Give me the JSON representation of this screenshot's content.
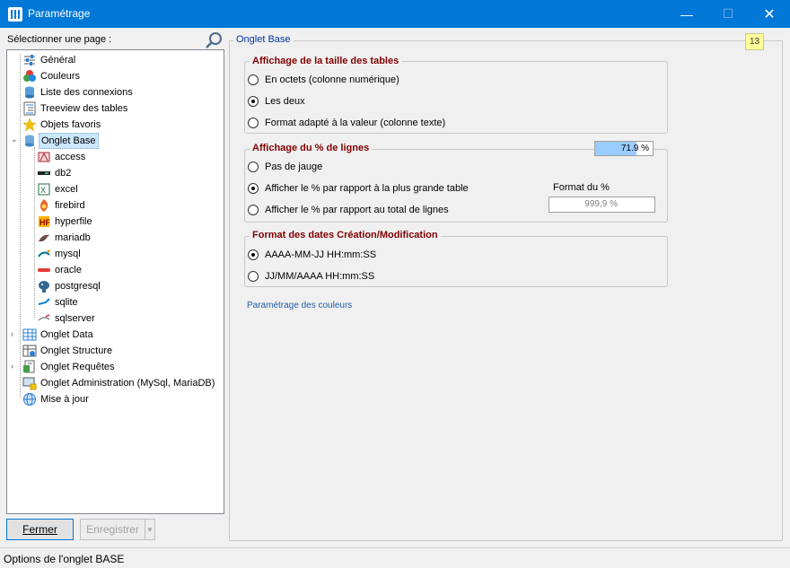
{
  "window": {
    "title": "Paramétrage"
  },
  "sidebar": {
    "label": "Sélectionner une page :",
    "tree": {
      "general": "Général",
      "couleurs": "Couleurs",
      "connexions": "Liste des connexions",
      "treeview": "Treeview des tables",
      "favoris": "Objets favoris",
      "onglet_base": "Onglet Base",
      "bases": [
        "access",
        "db2",
        "excel",
        "firebird",
        "hyperfile",
        "mariadb",
        "mysql",
        "oracle",
        "postgresql",
        "sqlite",
        "sqlserver"
      ],
      "onglet_data": "Onglet Data",
      "onglet_structure": "Onglet Structure",
      "onglet_requetes": "Onglet Requêtes",
      "onglet_admin": "Onglet Administration (MySql, MariaDB)",
      "mise_a_jour": "Mise à jour"
    }
  },
  "buttons": {
    "close": "Fermer",
    "save": "Enregistrer"
  },
  "status": "Options de l'onglet BASE",
  "main": {
    "title": "Onglet Base",
    "badge": "13",
    "group1": {
      "title": "Affichage de la taille des tables",
      "options": [
        "En octets (colonne numérique)",
        "Les deux",
        "Format adapté à la valeur (colonne texte)"
      ],
      "selected": 1
    },
    "group2": {
      "title": "Affichage du % de lignes",
      "gauge_text": "71.9 %",
      "gauge_fraction": 0.719,
      "options": [
        "Pas de jauge",
        "Afficher le % par rapport à la plus grande table",
        "Afficher le % par rapport au total de lignes"
      ],
      "selected": 1,
      "format_label": "Format du %",
      "format_value": "999,9 %"
    },
    "group3": {
      "title": "Format des dates Création/Modification",
      "options": [
        "AAAA-MM-JJ HH:mm:SS",
        "JJ/MM/AAAA HH:mm:SS"
      ],
      "selected": 0
    },
    "link": "Paramétrage des couleurs"
  },
  "colors": {
    "accent": "#0078d7",
    "group_title": "#800000",
    "link": "#1f5fa8",
    "badge": "#ffff99",
    "gauge": "#99ccff"
  }
}
